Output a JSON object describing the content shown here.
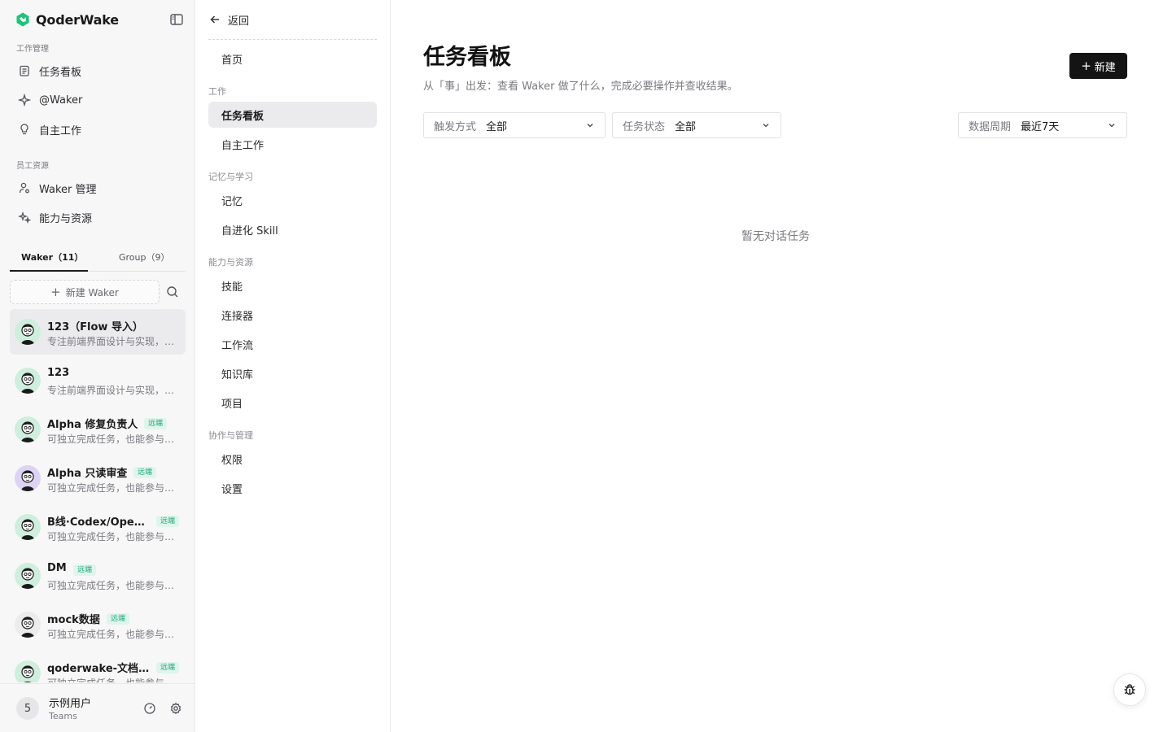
{
  "brand": {
    "name": "QoderWake",
    "accent": "#22c27a"
  },
  "sidebar": {
    "sections": [
      {
        "label": "工作管理",
        "items": [
          {
            "label": "任务看板",
            "icon": "clipboard-icon"
          },
          {
            "label": "@Waker",
            "icon": "sparkle-icon"
          },
          {
            "label": "自主工作",
            "icon": "lightbulb-icon"
          }
        ]
      },
      {
        "label": "员工资源",
        "items": [
          {
            "label": "Waker 管理",
            "icon": "user-gear-icon"
          },
          {
            "label": "能力与资源",
            "icon": "magic-icon"
          }
        ]
      }
    ],
    "tabs": [
      {
        "label": "Waker（11）"
      },
      {
        "label": "Group（9）"
      }
    ],
    "new_waker": "新建 Waker",
    "wakers": [
      {
        "name": "123（Flow 导入）",
        "desc": "专注前端界面设计与实现，擅长将设计稿转化为代码",
        "badge": "",
        "avatar_bg": "#cfeedd"
      },
      {
        "name": "123",
        "desc": "专注前端界面设计与实现，擅长将设计稿转化为代码",
        "badge": "",
        "avatar_bg": "#cfeedd"
      },
      {
        "name": "Alpha 修复负责人",
        "desc": "可独立完成任务，也能参与团队协作",
        "badge": "远端",
        "avatar_bg": "#cfeedd"
      },
      {
        "name": "Alpha 只读审查",
        "desc": "可独立完成任务，也能参与团队协作",
        "badge": "远端",
        "avatar_bg": "#dcd3f5"
      },
      {
        "name": "B线·Codex/OpenAI 执行",
        "desc": "可独立完成任务，也能参与团队协作",
        "badge": "远端",
        "avatar_bg": "#cfeedd"
      },
      {
        "name": "DM",
        "desc": "可独立完成任务，也能参与团队协作",
        "badge": "远端",
        "avatar_bg": "#cfeedd"
      },
      {
        "name": "mock数据",
        "desc": "可独立完成任务，也能参与团队协作",
        "badge": "远端",
        "avatar_bg": "#ececec"
      },
      {
        "name": "qoderwake-文档撰写助手",
        "desc": "可独立完成任务，也能参与团队协作",
        "badge": "远端",
        "avatar_bg": "#cfeedd"
      }
    ],
    "user": {
      "initial": "5",
      "name": "示例用户",
      "plan": "Teams"
    }
  },
  "subnav": {
    "back": "返回",
    "home": "首页",
    "groups": [
      {
        "label": "工作",
        "items": [
          "任务看板",
          "自主工作"
        ]
      },
      {
        "label": "记忆与学习",
        "items": [
          "记忆",
          "自进化 Skill"
        ]
      },
      {
        "label": "能力与资源",
        "items": [
          "技能",
          "连接器",
          "工作流",
          "知识库",
          "项目"
        ]
      },
      {
        "label": "协作与管理",
        "items": [
          "权限",
          "设置"
        ]
      }
    ]
  },
  "main": {
    "title": "任务看板",
    "subtitle": "从「事」出发：查看 Waker 做了什么，完成必要操作并查收结果。",
    "new_button": "新建",
    "filters": [
      {
        "label": "触发方式",
        "value": "全部"
      },
      {
        "label": "任务状态",
        "value": "全部"
      },
      {
        "label": "数据周期",
        "value": "最近7天"
      }
    ],
    "empty_text": "暂无对话任务"
  }
}
